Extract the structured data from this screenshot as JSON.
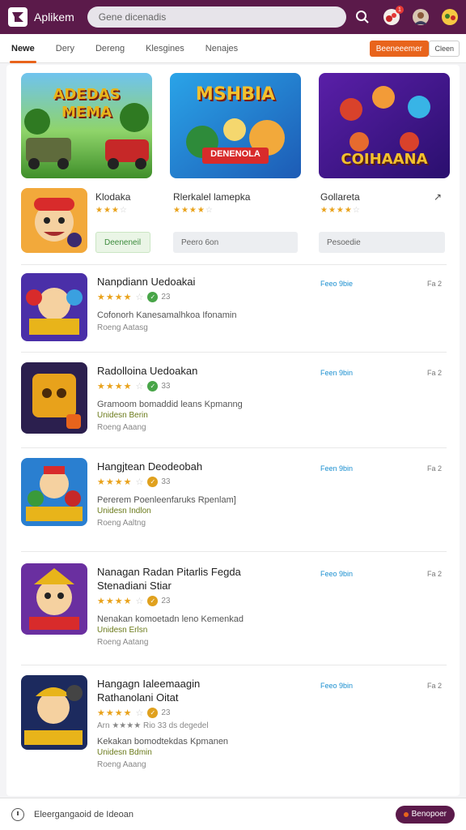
{
  "header": {
    "app_title": "Aplikem",
    "search_placeholder": "Gene dicenadis",
    "badge_count": "1"
  },
  "tabs": [
    {
      "label": "Newe"
    },
    {
      "label": "Dery"
    },
    {
      "label": "Dereng"
    },
    {
      "label": "Klesgines"
    },
    {
      "label": "Nenajes"
    }
  ],
  "actions": {
    "primary_label": "Beeneeemer",
    "secondary_label": "Cleen"
  },
  "featured": [
    {
      "label": "ADEDAS MEMA",
      "label_color": "#e8b41a"
    },
    {
      "label": "MSHBIA",
      "sub": "DENENOLA",
      "label_color": "#f2c12e"
    },
    {
      "label": "COIHAANA",
      "label_color": "#f2c12e"
    }
  ],
  "mini": [
    {
      "name": "Klodaka",
      "stars": 3,
      "box": "Deeneneil"
    },
    {
      "name": "Rlerkalel lamepka",
      "stars": 4,
      "box": "Peero 6on"
    },
    {
      "name": "Gollareta",
      "stars": 4,
      "box": "Pesoedie"
    }
  ],
  "list": [
    {
      "title": "Nanpdiann Uedoakai",
      "title2": "",
      "rating_count": "23",
      "desc": "Cofonorh Kanesamalhkoa Ifonamin",
      "sub": "",
      "meta": "Roeng  Aatasg",
      "free": "Feeo 9bie",
      "rank": "Fa 2",
      "badge_color": "green"
    },
    {
      "title": "Radolloina Uedoakan",
      "title2": "",
      "rating_count": "33",
      "desc": "Gramoom bomaddid leans Kpmanng",
      "sub": "Unidesn Berin",
      "meta": "Roeng  Aaang",
      "free": "Feen 9bin",
      "rank": "Fa 2",
      "badge_color": "green"
    },
    {
      "title": "Hangjtean Deodeobah",
      "title2": "",
      "rating_count": "33",
      "desc": "Pererem Poenleenfaruks Rpenlam]",
      "sub": "Unidesn Indlon",
      "meta": "Roeng  Aaltng",
      "free": "Feen 9bin",
      "rank": "Fa 2",
      "badge_color": "gold"
    },
    {
      "title": "Nanagan Radan Pitarlis Fegda",
      "title2": "Stenadiani Stiar",
      "rating_count": "23",
      "desc": "Nenakan komoetadn leno Kemenkad",
      "sub": "Unidesn Erlsn",
      "meta": "Roeng  Aatang",
      "free": "Feeo 9bin",
      "rank": "Fa 2",
      "badge_color": "gold"
    },
    {
      "title": "Hangagn Ialeemaagin",
      "title2": "Rathanolani Oitat",
      "rating_count": "23",
      "desc2": "Arn ★★★★ Rio 33 ds degedel",
      "desc": "Kekakan bomodtekdas Kpmanen",
      "sub": "Unidesn Bdmin",
      "meta": "Roeng  Aaang",
      "free": "Feeo 9bin",
      "rank": "Fa 2",
      "badge_color": "gold"
    }
  ],
  "footer": {
    "text": "Eleergangaoid de Ideoan",
    "button": "Benopoer"
  },
  "colors": {
    "brand": "#5b1a4a",
    "accent": "#e8641c",
    "star": "#e9a21b"
  }
}
